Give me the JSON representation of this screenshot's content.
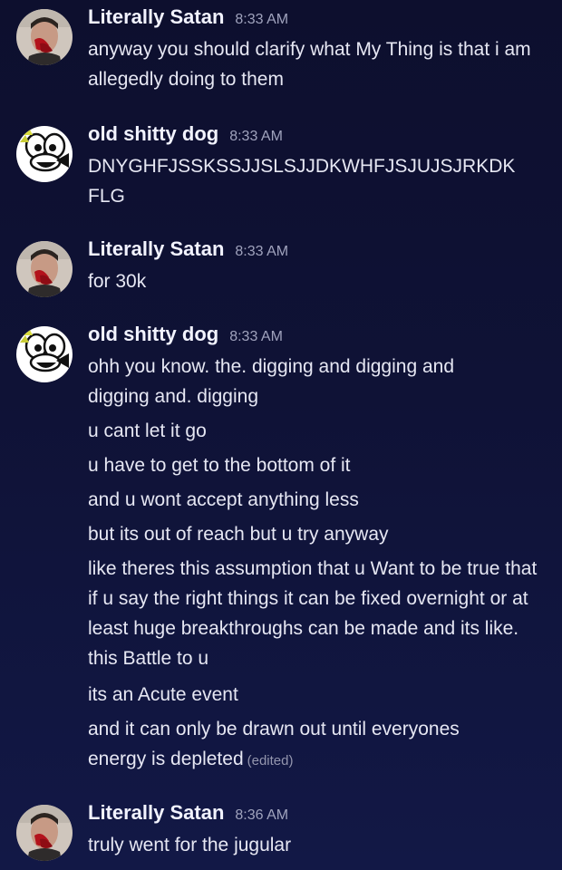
{
  "users": {
    "satan": "Literally Satan",
    "dog": "old shitty dog"
  },
  "messages": [
    {
      "time": "8:33 AM",
      "lines": [
        "anyway you should clarify what My Thing is that i am allegedly doing to them"
      ]
    },
    {
      "time": "8:33 AM",
      "lines": [
        "DNYGHFJSSKSSJJSLSJJDKWHFJSJUJSJRKDK FLG"
      ]
    },
    {
      "time": "8:33 AM",
      "lines": [
        "for 30k"
      ]
    },
    {
      "time": "8:33 AM",
      "lines": [
        "ohh you know. the. digging and digging and digging and. digging",
        "u cant let it go",
        "u have to get to the bottom of it",
        "and u wont accept anything less",
        "but its out of reach but u try anyway",
        "like theres this assumption that u Want to be true that if u say the right things it can be fixed overnight or at least huge breakthroughs can be made and its like. this Battle to u",
        "its an Acute event",
        "and it can only be drawn out until everyones energy is depleted"
      ],
      "edited": "(edited)"
    },
    {
      "time": "8:36 AM",
      "lines": [
        "truly went for the jugular"
      ]
    }
  ]
}
